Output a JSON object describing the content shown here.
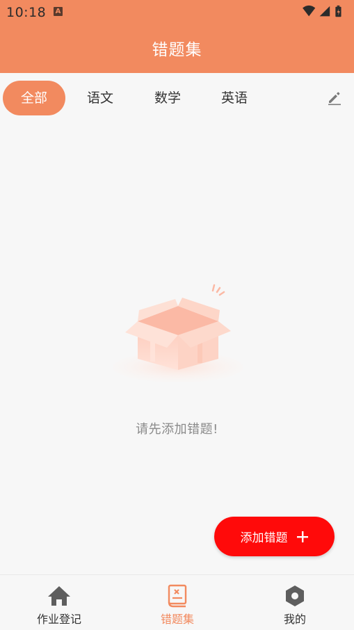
{
  "status_bar": {
    "time": "10:18",
    "notification_icon": "a-icon",
    "icons": [
      "wifi-icon",
      "signal-icon",
      "battery-icon"
    ]
  },
  "app_bar": {
    "title": "错题集"
  },
  "tabs": [
    {
      "label": "全部",
      "active": true
    },
    {
      "label": "语文",
      "active": false
    },
    {
      "label": "数学",
      "active": false
    },
    {
      "label": "英语",
      "active": false
    }
  ],
  "tabs_edit_icon": "pencil-icon",
  "empty_state": {
    "icon": "open-box-icon",
    "message": "请先添加错题!"
  },
  "fab": {
    "label": "添加错题",
    "icon": "plus-icon"
  },
  "bottom_nav": [
    {
      "label": "作业登记",
      "icon": "home-icon",
      "active": false
    },
    {
      "label": "错题集",
      "icon": "notebook-icon",
      "active": true
    },
    {
      "label": "我的",
      "icon": "hexagon-icon",
      "active": false
    }
  ],
  "colors": {
    "primary": "#f28a5f",
    "fab": "#ff0a0a",
    "background": "#f7f7f7"
  }
}
